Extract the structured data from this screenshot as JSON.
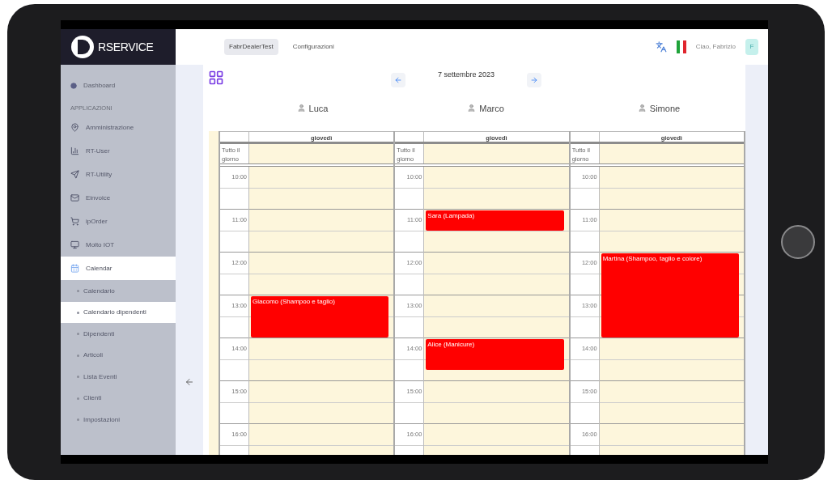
{
  "logo": {
    "text": "RSERVICE"
  },
  "sidebar": {
    "top_item": {
      "label": "Dashboard"
    },
    "section": "APPLICAZIONI",
    "items": [
      {
        "label": "Amministrazione",
        "expanded": false
      },
      {
        "label": "RT-User",
        "expanded": false
      },
      {
        "label": "RT-Utility",
        "expanded": false
      },
      {
        "label": "Einvoice",
        "expanded": false
      },
      {
        "label": "ipOrder",
        "expanded": false
      },
      {
        "label": "Molto IOT",
        "expanded": false
      },
      {
        "label": "Calendar",
        "expanded": true,
        "children": [
          {
            "label": "Calendario",
            "selected": false
          },
          {
            "label": "Calendario dipendenti",
            "selected": true
          },
          {
            "label": "Dipendenti",
            "selected": false
          },
          {
            "label": "Articoli",
            "selected": false
          },
          {
            "label": "Lista Eventi",
            "selected": false
          },
          {
            "label": "Clienti",
            "selected": false
          },
          {
            "label": "Impostazioni",
            "selected": false
          }
        ]
      }
    ]
  },
  "topbar": {
    "tabs": [
      {
        "label": "FabrDealerTest",
        "selected": true
      },
      {
        "label": "Configurazioni",
        "selected": false
      }
    ],
    "greeting": "Ciao, Fabrizio",
    "avatar": "F"
  },
  "calendar": {
    "date": "7 settembre 2023",
    "columns": [
      {
        "name": "Luca",
        "day": "giovedì",
        "all_day": "Tutto il giorno",
        "hours": [
          {
            "time": "10:00"
          },
          {
            "time": "11:00"
          },
          {
            "time": "12:00"
          },
          {
            "time": "13:00",
            "events": [
              {
                "title": "Giacomo (Shampoo e taglio)",
                "kind": "hour"
              }
            ]
          },
          {
            "time": "14:00"
          },
          {
            "time": "15:00"
          },
          {
            "time": "16:00"
          }
        ]
      },
      {
        "name": "Marco",
        "day": "giovedì",
        "all_day": "Tutto il giorno",
        "hours": [
          {
            "time": "10:00"
          },
          {
            "time": "11:00",
            "events": [
              {
                "title": "Sara (Lampada)",
                "kind": "halfhour"
              }
            ]
          },
          {
            "time": "12:00"
          },
          {
            "time": "13:00"
          },
          {
            "time": "14:00",
            "events": [
              {
                "title": "Alice (Manicure)",
                "kind": "longhalfhour"
              }
            ]
          },
          {
            "time": "15:00"
          },
          {
            "time": "16:00"
          }
        ]
      },
      {
        "name": "Simone",
        "day": "giovedì",
        "all_day": "Tutto il giorno",
        "hours": [
          {
            "time": "10:00"
          },
          {
            "time": "11:00"
          },
          {
            "time": "12:00",
            "events": [
              {
                "title": "Martina (Shampoo, taglio e colore)",
                "kind": "twohours"
              }
            ]
          },
          {
            "time": "13:00"
          },
          {
            "time": "14:00"
          },
          {
            "time": "15:00"
          },
          {
            "time": "16:00"
          }
        ]
      }
    ]
  }
}
